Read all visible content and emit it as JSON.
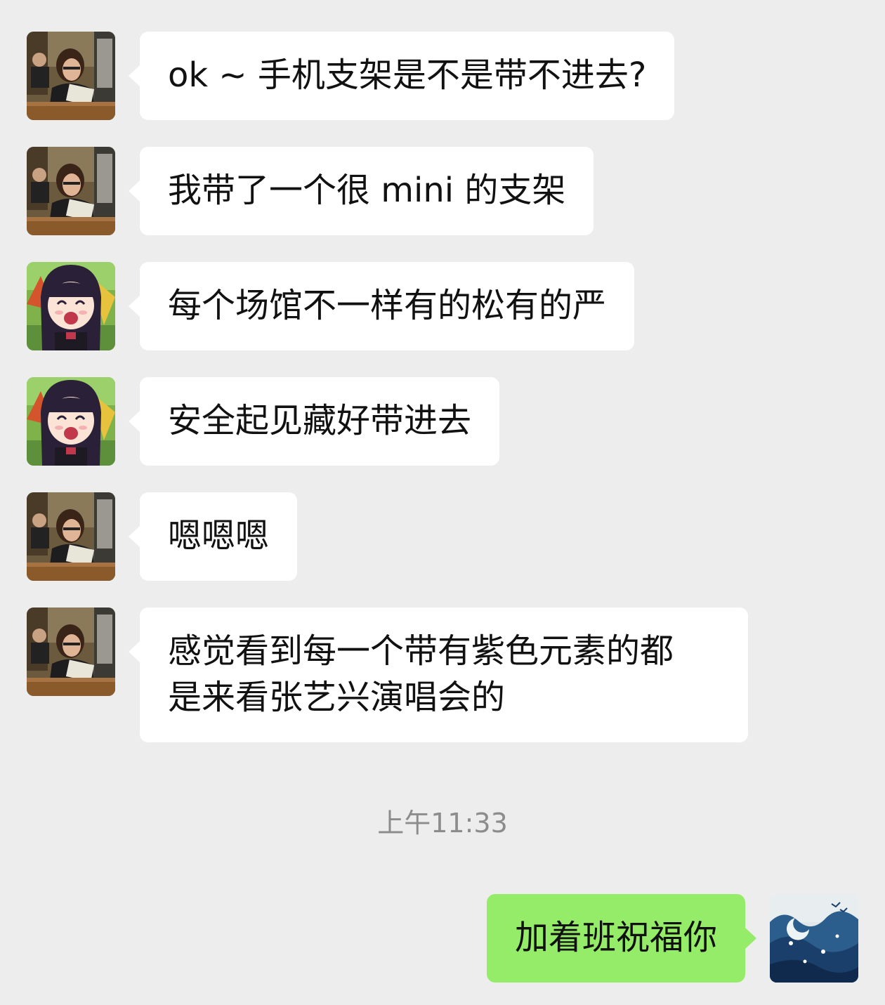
{
  "chat": {
    "messages": [
      {
        "sender": "contact-a",
        "lines": [
          "ok ~ 手机支架是不是带不进去?"
        ]
      },
      {
        "sender": "contact-a",
        "lines": [
          "我带了一个很 mini 的支架"
        ]
      },
      {
        "sender": "contact-b",
        "lines": [
          "每个场馆不一样有的松有的严"
        ]
      },
      {
        "sender": "contact-b",
        "lines": [
          "安全起见藏好带进去"
        ]
      },
      {
        "sender": "contact-a",
        "lines": [
          "嗯嗯嗯"
        ]
      },
      {
        "sender": "contact-a",
        "lines": [
          "感觉看到每一个带有紫色元素的都",
          "是来看张艺兴演唱会的"
        ]
      }
    ],
    "timestamp": "上午11:33",
    "outgoing": [
      {
        "sender": "me",
        "lines": [
          "加着班祝福你"
        ]
      }
    ]
  },
  "colors": {
    "background": "#ededed",
    "incoming_bubble": "#ffffff",
    "outgoing_bubble": "#95ec69",
    "timestamp_text": "#8c8c8c"
  },
  "icons": {
    "contact_a_avatar": "classroom-photo-avatar",
    "contact_b_avatar": "anime-girl-avatar",
    "my_avatar": "ocean-wave-avatar"
  }
}
